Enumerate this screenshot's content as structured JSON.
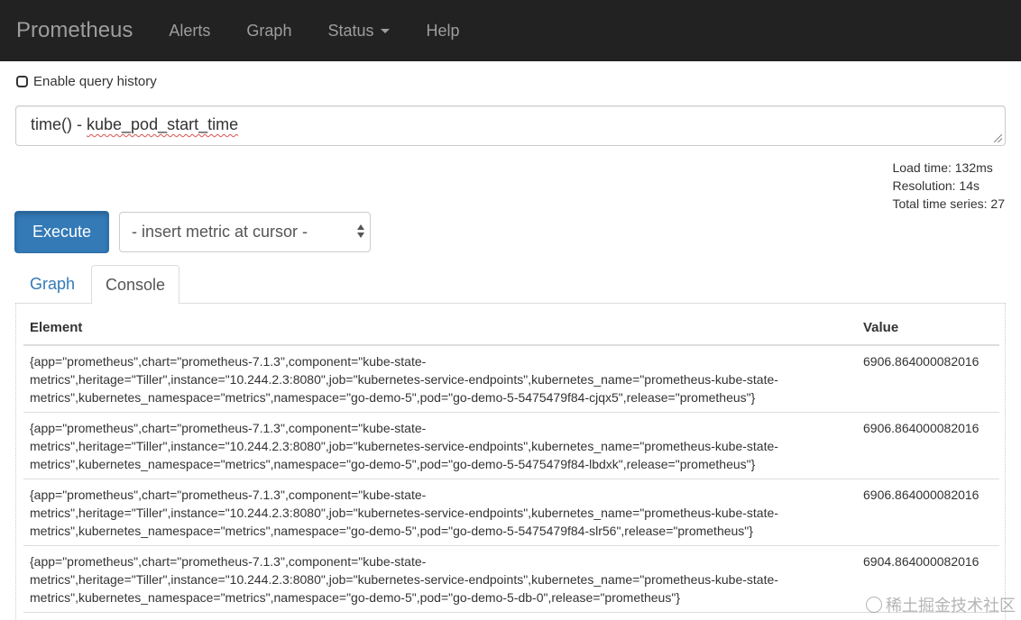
{
  "navbar": {
    "brand": "Prometheus",
    "items": [
      {
        "label": "Alerts"
      },
      {
        "label": "Graph"
      },
      {
        "label": "Status"
      },
      {
        "label": "Help"
      }
    ]
  },
  "history": {
    "label": "Enable query history",
    "checked": false
  },
  "expression": {
    "prefix": "time() - ",
    "metric": "kube_pod_start_time"
  },
  "stats": {
    "load_time": "Load time: 132ms",
    "resolution": "Resolution: 14s",
    "total_series": "Total time series: 27"
  },
  "controls": {
    "execute_label": "Execute",
    "metric_select": "- insert metric at cursor -"
  },
  "tabs": [
    {
      "label": "Graph",
      "active": false
    },
    {
      "label": "Console",
      "active": true
    }
  ],
  "table": {
    "headers": {
      "element": "Element",
      "value": "Value"
    },
    "rows": [
      {
        "element_lines": [
          "{app=\"prometheus\",chart=\"prometheus-7.1.3\",component=\"kube-state-",
          "metrics\",heritage=\"Tiller\",instance=\"10.244.2.3:8080\",job=\"kubernetes-service-endpoints\",kubernetes_name=\"prometheus-kube-state-",
          "metrics\",kubernetes_namespace=\"metrics\",namespace=\"go-demo-5\",pod=\"go-demo-5-5475479f84-cjqx5\",release=\"prometheus\"}"
        ],
        "value": "6906.864000082016"
      },
      {
        "element_lines": [
          "{app=\"prometheus\",chart=\"prometheus-7.1.3\",component=\"kube-state-",
          "metrics\",heritage=\"Tiller\",instance=\"10.244.2.3:8080\",job=\"kubernetes-service-endpoints\",kubernetes_name=\"prometheus-kube-state-",
          "metrics\",kubernetes_namespace=\"metrics\",namespace=\"go-demo-5\",pod=\"go-demo-5-5475479f84-lbdxk\",release=\"prometheus\"}"
        ],
        "value": "6906.864000082016"
      },
      {
        "element_lines": [
          "{app=\"prometheus\",chart=\"prometheus-7.1.3\",component=\"kube-state-",
          "metrics\",heritage=\"Tiller\",instance=\"10.244.2.3:8080\",job=\"kubernetes-service-endpoints\",kubernetes_name=\"prometheus-kube-state-",
          "metrics\",kubernetes_namespace=\"metrics\",namespace=\"go-demo-5\",pod=\"go-demo-5-5475479f84-slr56\",release=\"prometheus\"}"
        ],
        "value": "6906.864000082016"
      },
      {
        "element_lines": [
          "{app=\"prometheus\",chart=\"prometheus-7.1.3\",component=\"kube-state-",
          "metrics\",heritage=\"Tiller\",instance=\"10.244.2.3:8080\",job=\"kubernetes-service-endpoints\",kubernetes_name=\"prometheus-kube-state-",
          "metrics\",kubernetes_namespace=\"metrics\",namespace=\"go-demo-5\",pod=\"go-demo-5-db-0\",release=\"prometheus\"}"
        ],
        "value": "6904.864000082016"
      }
    ]
  },
  "watermark": "稀土掘金技术社区"
}
